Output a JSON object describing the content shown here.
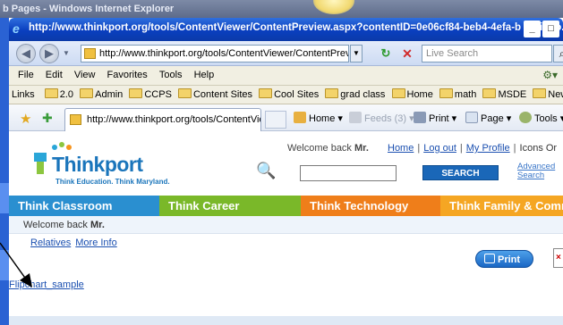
{
  "outer_window": {
    "title": "b Pages - Windows Internet Explorer"
  },
  "ie_window": {
    "title": "http://www.thinkport.org/tools/ContentViewer/ContentPreview.aspx?contentID=0e06cf84-beb4-4efa-b - Windo...",
    "controls": [
      "_",
      "□"
    ]
  },
  "address_bar": {
    "url": "http://www.thinkport.org/tools/ContentViewer/ContentPreview",
    "search_placeholder": "Live Search"
  },
  "menu": [
    "File",
    "Edit",
    "View",
    "Favorites",
    "Tools",
    "Help"
  ],
  "links_bar": {
    "label": "Links",
    "items": [
      "2.0",
      "Admin",
      "CCPS",
      "Content Sites",
      "Cool Sites",
      "grad class",
      "Home",
      "math",
      "MSDE",
      "News"
    ]
  },
  "command_bar": {
    "tab_title": "http://www.thinkport.org/tools/ContentView...",
    "commands": [
      "Home",
      "Feeds (3)",
      "Print",
      "Page",
      "Tools"
    ]
  },
  "site": {
    "logo": "Thinkport",
    "tagline": "Think Education. Think Maryland.",
    "welcome_prefix": "Welcome back ",
    "user": "Mr.",
    "top_links": [
      "Home",
      "Log out",
      "My Profile",
      "Icons Or"
    ],
    "search_button": "SEARCH",
    "advanced_search": "Advanced Search",
    "nav": [
      {
        "label": "Think Classroom",
        "color": "#2a8fd0"
      },
      {
        "label": "Think Career",
        "color": "#7ab829"
      },
      {
        "label": "Think Technology",
        "color": "#ef7e1a"
      },
      {
        "label": "Think Family & Comm",
        "color": "#f5a623"
      }
    ],
    "welcome_bar_prefix": "Welcome back ",
    "subnav": [
      "Relatives",
      "More Info"
    ],
    "print_label": "Print",
    "close_label": "×",
    "content_link": "Flipchart_sample"
  },
  "colors": {
    "ie_title": "#0a3fbf",
    "link": "#1a4fb0",
    "brand": "#1a75bb"
  }
}
